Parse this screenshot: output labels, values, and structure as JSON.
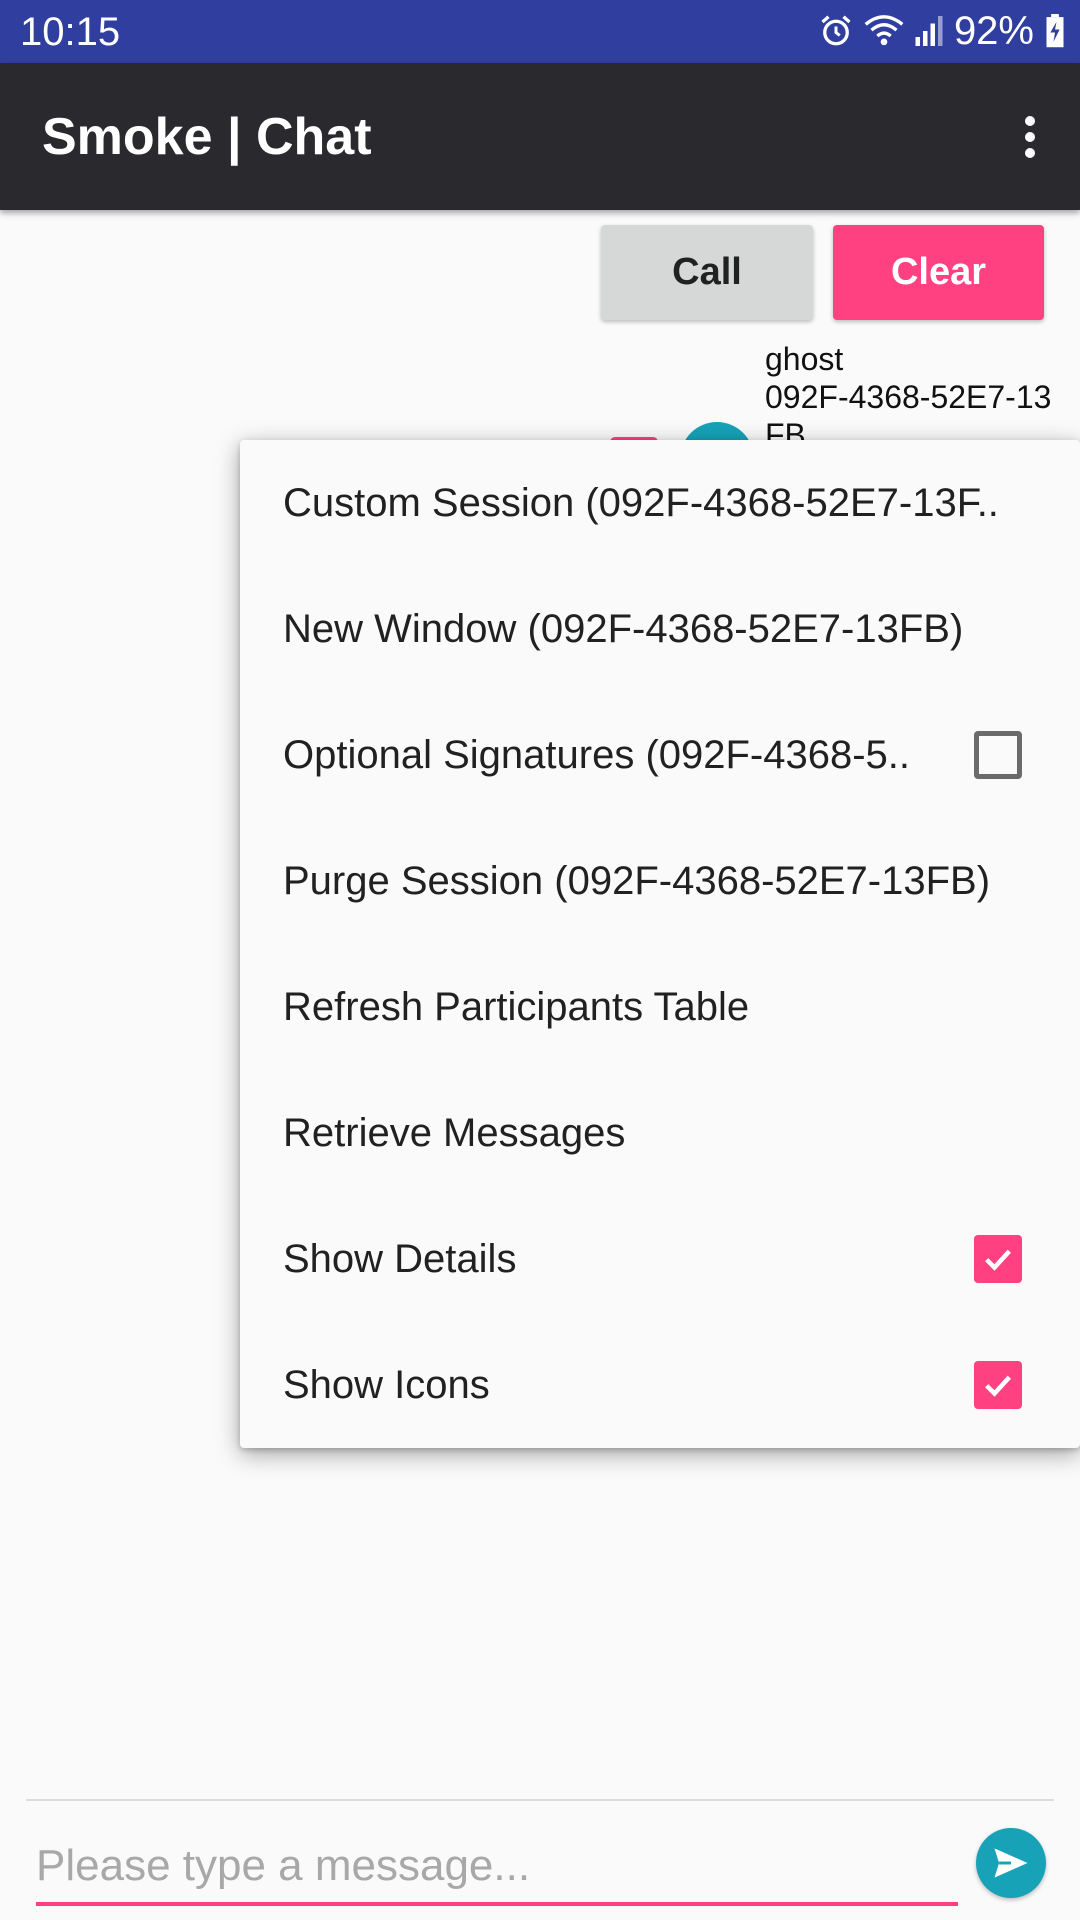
{
  "status_bar": {
    "time": "10:15",
    "battery": "92%",
    "icons": [
      "alarm-icon",
      "wifi-icon",
      "signal-icon",
      "battery-charging-icon"
    ]
  },
  "app_bar": {
    "title": "Smoke | Chat",
    "overflow_icon": "more-vert-icon"
  },
  "buttons": {
    "call_label": "Call",
    "clear_label": "Clear"
  },
  "participant": {
    "name": "ghost",
    "id": "092F-4368-52E7-13FB",
    "selected": true
  },
  "menu": {
    "items": [
      {
        "label": "Custom Session (092F-4368-52E7-13F..",
        "checkbox": null
      },
      {
        "label": "New Window (092F-4368-52E7-13FB)",
        "checkbox": null
      },
      {
        "label": "Optional Signatures (092F-4368-5..",
        "checkbox": false
      },
      {
        "label": "Purge Session (092F-4368-52E7-13FB)",
        "checkbox": null
      },
      {
        "label": "Refresh Participants Table",
        "checkbox": null
      },
      {
        "label": "Retrieve Messages",
        "checkbox": null
      },
      {
        "label": "Show Details",
        "checkbox": true
      },
      {
        "label": "Show Icons",
        "checkbox": true
      }
    ]
  },
  "composer": {
    "placeholder": "Please type a message...",
    "value": "",
    "send_icon": "send-icon"
  },
  "colors": {
    "status_bar": "#303f9f",
    "app_bar": "#2a292e",
    "accent": "#ff4081",
    "teal": "#17a2b8"
  }
}
